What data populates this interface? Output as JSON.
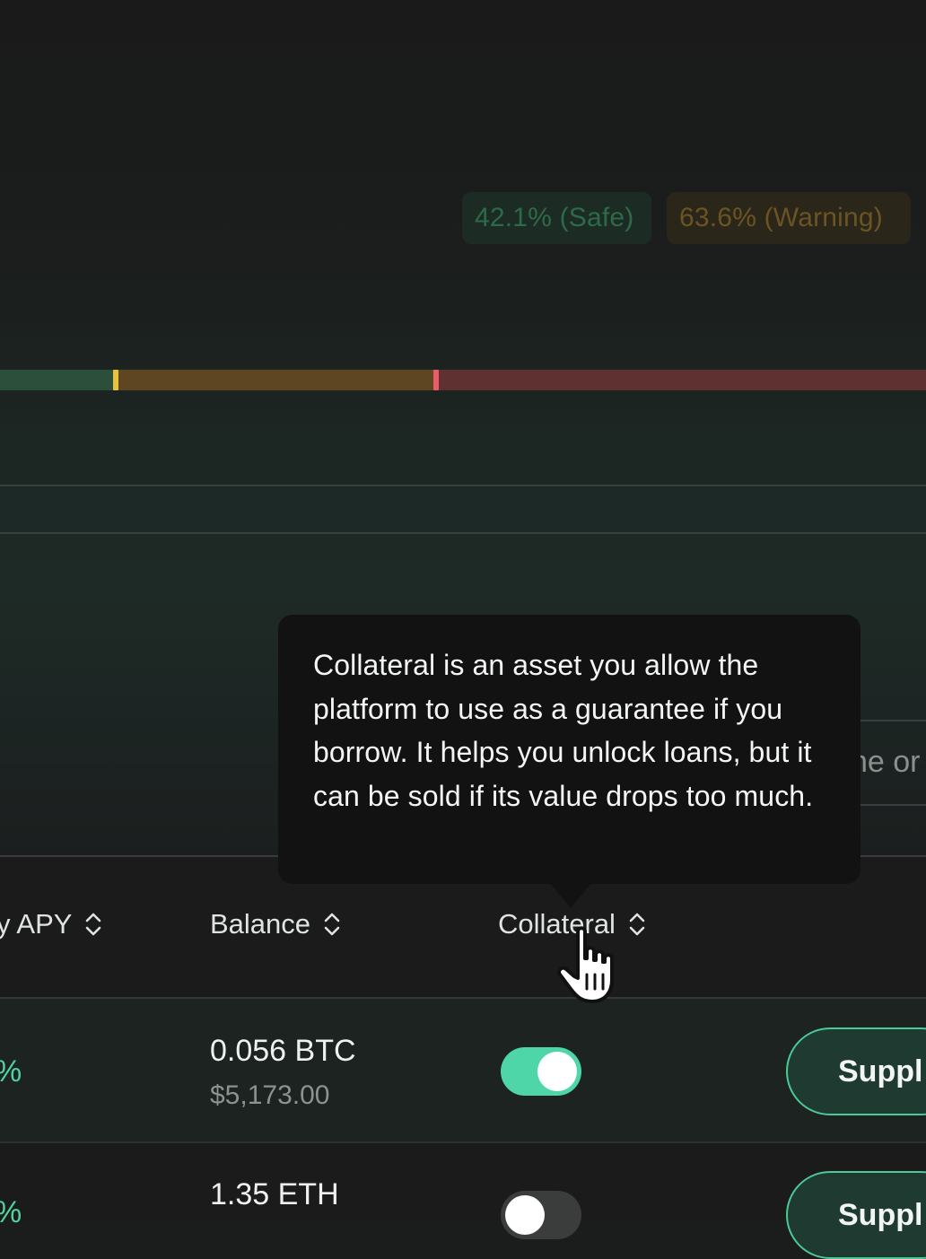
{
  "health_pills": {
    "safe_label": "42.1% (Safe)",
    "warning_label": "63.6% (Warning)"
  },
  "risk_bar": {
    "safe_threshold_percent": 42.1,
    "warning_threshold_percent": 63.6,
    "colors": {
      "safe": "#2b4f3a",
      "warning": "#5e4622",
      "danger": "#5f3130",
      "safe_marker": "#e8c23f",
      "warning_marker": "#e75c67"
    }
  },
  "search": {
    "visible_text": "ne or"
  },
  "tooltip": {
    "text": "Collateral is an asset you allow the platform to use as a guarantee if you borrow. It helps you unlock loans, but it can be sold if its value drops too much."
  },
  "table": {
    "headers": {
      "apy": "y APY",
      "balance": "Balance",
      "collateral": "Collateral"
    },
    "rows": [
      {
        "apy": "%",
        "balance": "0.056 BTC",
        "balance_usd": "$5,173.00",
        "collateral_enabled": true,
        "action": "Suppl"
      },
      {
        "apy": "%",
        "balance": "1.35 ETH",
        "balance_usd": "",
        "collateral_enabled": false,
        "action": "Suppl"
      }
    ]
  },
  "colors": {
    "accent": "#4fd6a8",
    "apy_green": "#4fd39e",
    "tooltip_bg": "#121212"
  },
  "icons": {
    "sort": "chevron-up-down-icon",
    "cursor": "hand-pointer-icon"
  }
}
